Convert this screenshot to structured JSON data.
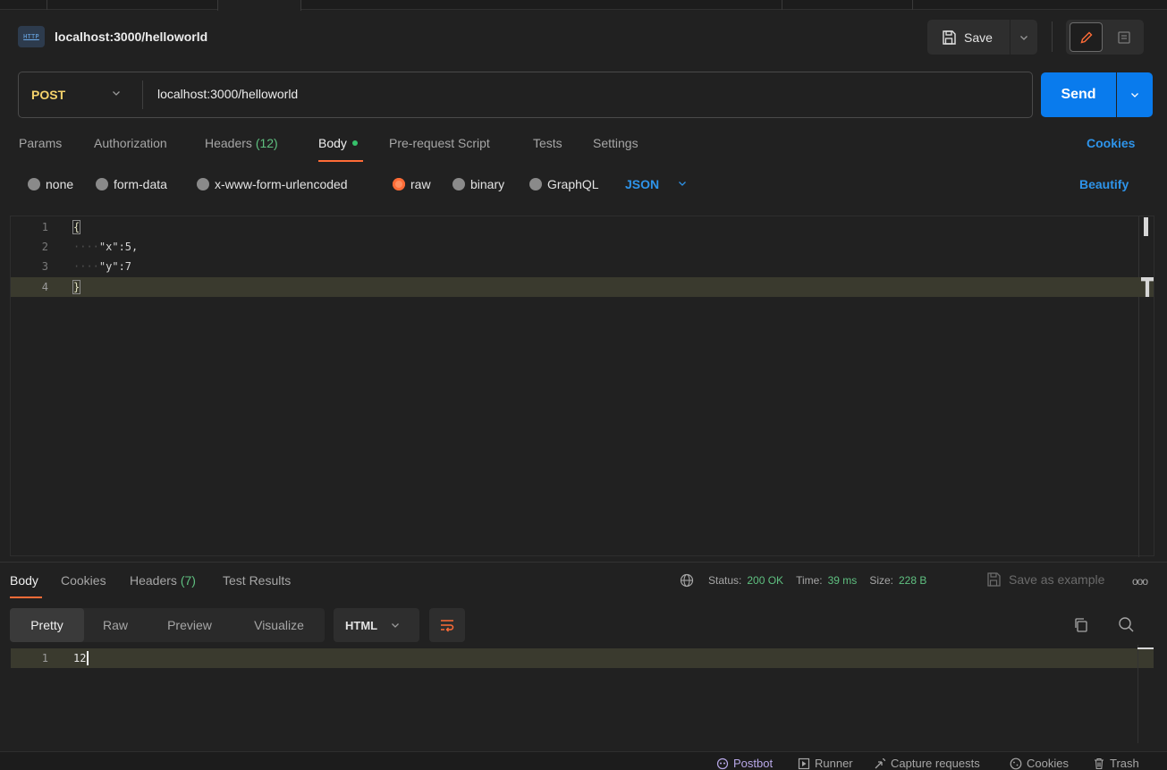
{
  "header": {
    "http_badge": "HTTP",
    "request_name": "localhost:3000/helloworld",
    "save_label": "Save"
  },
  "url_bar": {
    "method": "POST",
    "url": "localhost:3000/helloworld",
    "send_label": "Send"
  },
  "request_tabs": {
    "params": "Params",
    "authorization": "Authorization",
    "headers_label": "Headers",
    "headers_count": "(12)",
    "body": "Body",
    "pre_request": "Pre-request Script",
    "tests": "Tests",
    "settings": "Settings",
    "cookies": "Cookies"
  },
  "body_types": {
    "none": "none",
    "form_data": "form-data",
    "urlencoded": "x-www-form-urlencoded",
    "raw": "raw",
    "binary": "binary",
    "graphql": "GraphQL",
    "format": "JSON",
    "beautify": "Beautify"
  },
  "editor": {
    "lines": [
      {
        "num": "1",
        "text": "{"
      },
      {
        "num": "2",
        "text": "\"x\":5,"
      },
      {
        "num": "3",
        "text": "\"y\":7"
      },
      {
        "num": "4",
        "text": "}"
      }
    ]
  },
  "response": {
    "tabs": {
      "body": "Body",
      "cookies": "Cookies",
      "headers_label": "Headers",
      "headers_count": "(7)",
      "test_results": "Test Results"
    },
    "status_label": "Status:",
    "status_value": "200 OK",
    "time_label": "Time:",
    "time_value": "39 ms",
    "size_label": "Size:",
    "size_value": "228 B",
    "save_example": "Save as example",
    "more": "ooo",
    "views": {
      "pretty": "Pretty",
      "raw": "Raw",
      "preview": "Preview",
      "visualize": "Visualize"
    },
    "format": "HTML",
    "line_num": "1",
    "line_text": "12"
  },
  "statusbar": {
    "postbot": "Postbot",
    "runner": "Runner",
    "capture": "Capture requests",
    "cookies": "Cookies",
    "trash": "Trash"
  }
}
